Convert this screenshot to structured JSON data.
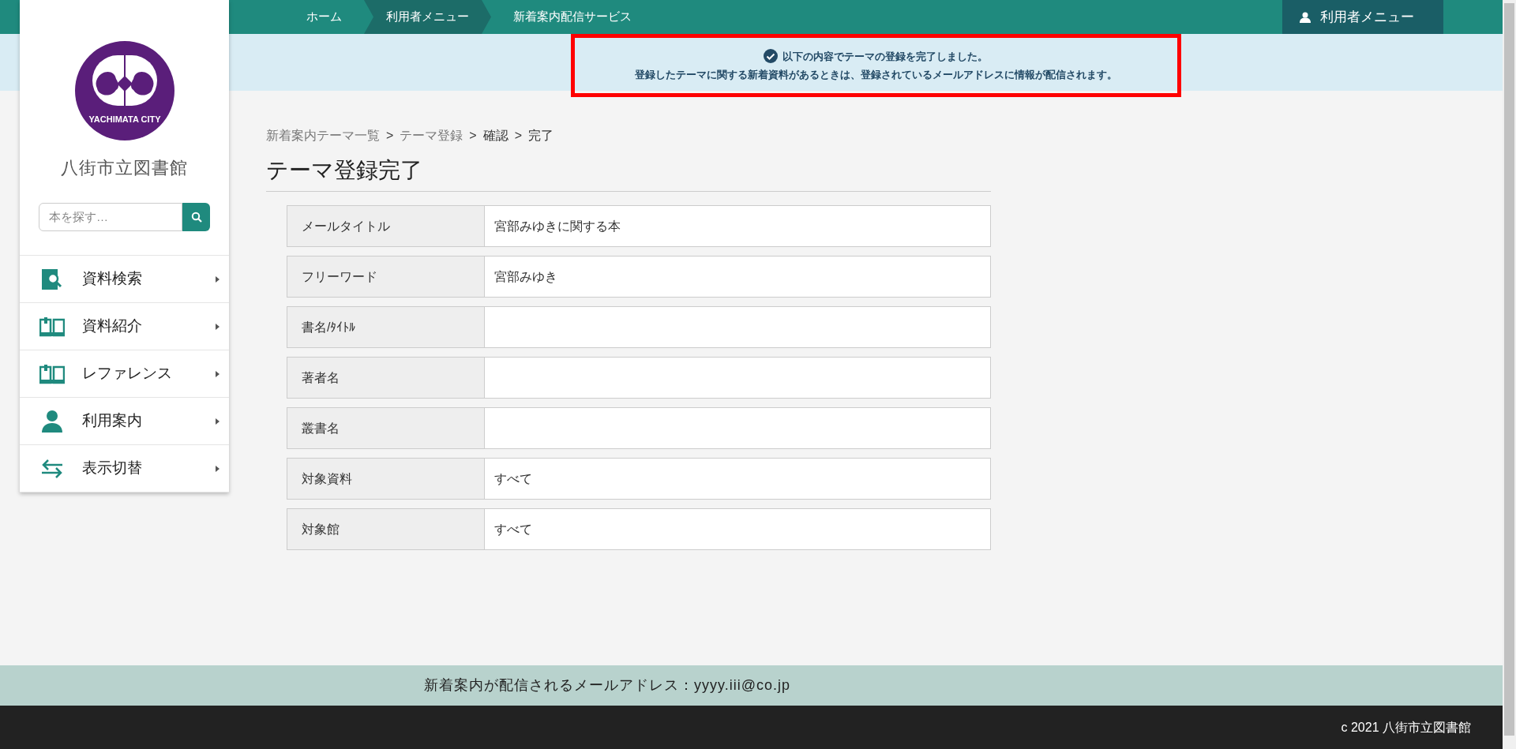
{
  "top_nav": {
    "crumbs": [
      {
        "label": "ホーム",
        "selected": false
      },
      {
        "label": "利用者メニュー",
        "selected": true
      },
      {
        "label": "新着案内配信サービス",
        "selected": false
      }
    ],
    "user_menu": "利用者メニュー"
  },
  "notice": {
    "lines": [
      "以下の内容でテーマの登録を完了しました。",
      "登録したテーマに関する新着資料があるときは、登録されているメールアドレスに情報が配信されます。"
    ],
    "highlighted": true
  },
  "sidebar": {
    "logo_text": "YACHIMATA CITY",
    "library_name": "八街市立図書館",
    "search": {
      "placeholder": "本を探す…"
    },
    "items": [
      {
        "label": "資料検索",
        "kind": "search"
      },
      {
        "label": "資料紹介",
        "kind": "book"
      },
      {
        "label": "レファレンス",
        "kind": "book"
      },
      {
        "label": "利用案内",
        "kind": "person"
      },
      {
        "label": "表示切替",
        "kind": "swap"
      }
    ]
  },
  "breadcrumb": [
    {
      "label": "新着案内テーマ一覧",
      "link": true
    },
    {
      "label": "テーマ登録",
      "link": true
    },
    {
      "label": "確認",
      "link": false
    },
    {
      "label": "完了",
      "link": false
    }
  ],
  "breadcrumb_separator": ">",
  "title": "テーマ登録完了",
  "table": {
    "rows": [
      {
        "label": "メールタイトル",
        "value": "宮部みゆきに関する本"
      },
      {
        "label": "フリーワード",
        "value": "宮部みゆき"
      },
      {
        "label": "書名/ﾀｲﾄﾙ",
        "value": ""
      },
      {
        "label": "著者名",
        "value": ""
      },
      {
        "label": "叢書名",
        "value": ""
      },
      {
        "label": "対象資料",
        "value": "すべて"
      },
      {
        "label": "対象館",
        "value": "すべて"
      }
    ]
  },
  "footer": {
    "email_line": "新着案内が配信されるメールアドレス：yyyy.iii@co.jp",
    "copyright": "c 2021 八街市立図書館"
  }
}
